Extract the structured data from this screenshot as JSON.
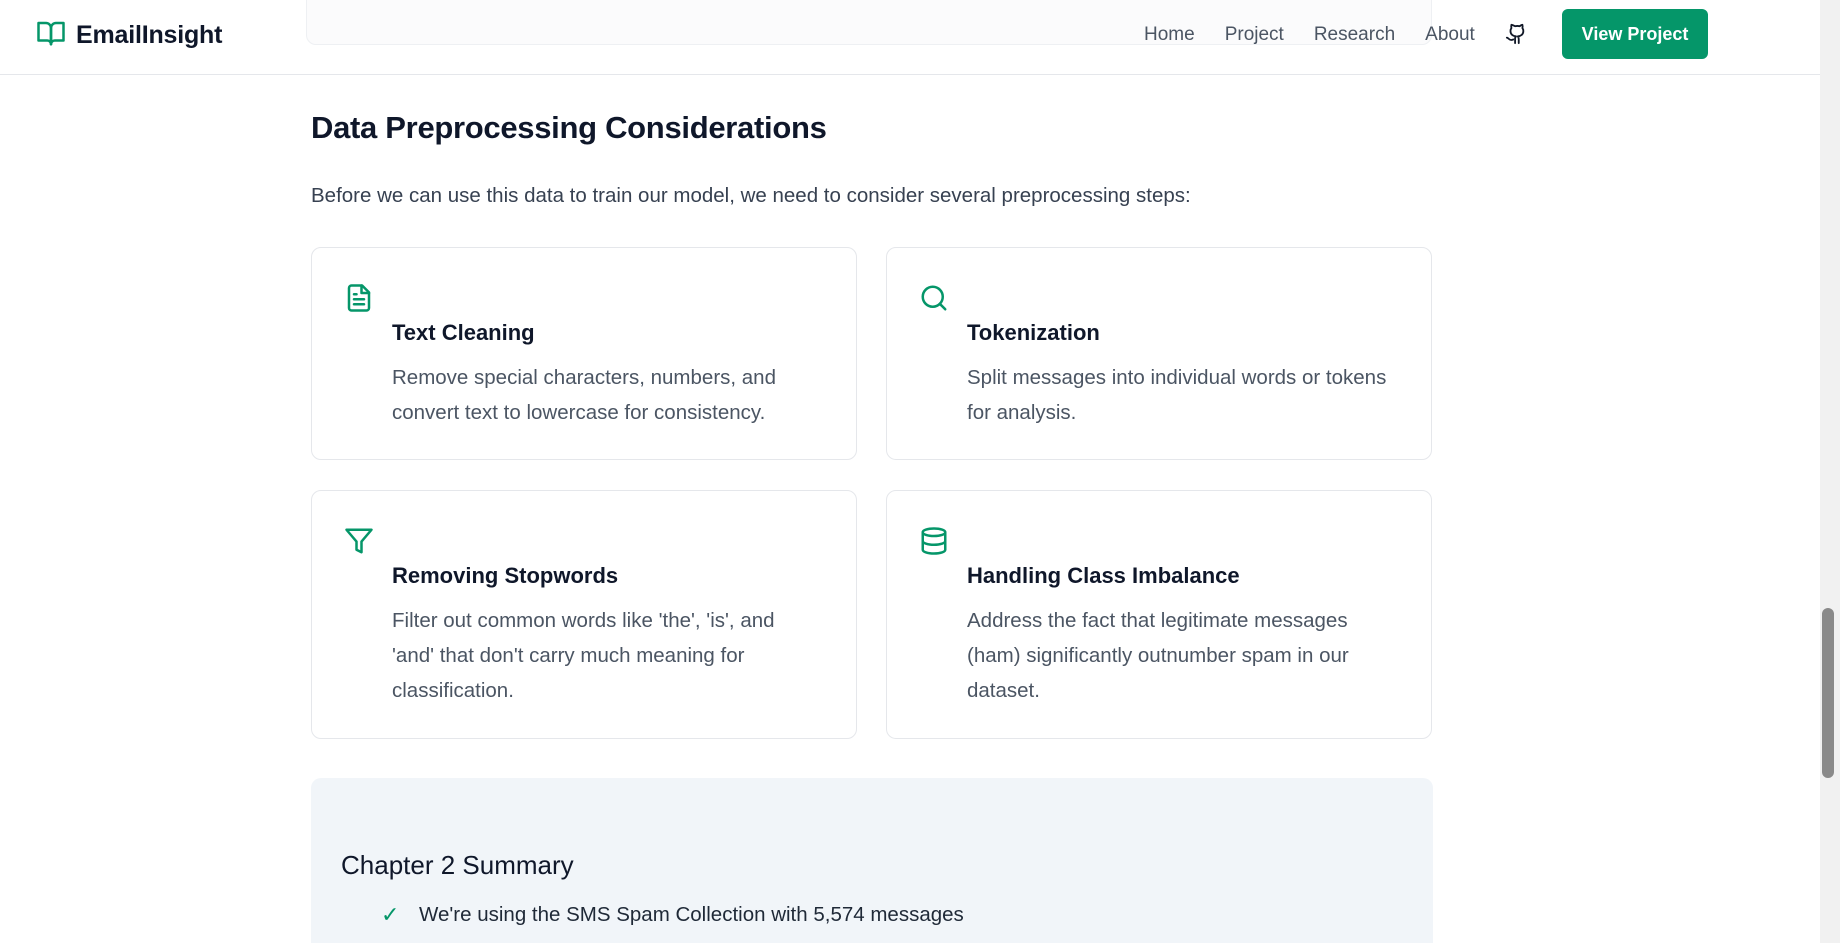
{
  "header": {
    "brand_name": "EmailInsight",
    "nav": [
      "Home",
      "Project",
      "Research",
      "About"
    ],
    "cta_label": "View Project"
  },
  "section": {
    "title": "Data Preprocessing Considerations",
    "intro": "Before we can use this data to train our model, we need to consider several preprocessing steps:"
  },
  "cards": [
    {
      "icon": "document-icon",
      "title": "Text Cleaning",
      "text": "Remove special characters, numbers, and convert text to lowercase for consistency."
    },
    {
      "icon": "search-icon",
      "title": "Tokenization",
      "text": "Split messages into individual words or tokens for analysis."
    },
    {
      "icon": "filter-icon",
      "title": "Removing Stopwords",
      "text": "Filter out common words like 'the', 'is', and 'and' that don't carry much meaning for classification."
    },
    {
      "icon": "database-icon",
      "title": "Handling Class Imbalance",
      "text": "Address the fact that legitimate messages (ham) significantly outnumber spam in our dataset."
    }
  ],
  "summary": {
    "title": "Chapter 2 Summary",
    "check_mark": "✓",
    "items": [
      "We're using the SMS Spam Collection with 5,574 messages"
    ]
  },
  "colors": {
    "accent": "#059669",
    "summary_bg": "#f1f5f9",
    "text_dark": "#0f172a",
    "text_muted": "#4b5563"
  }
}
